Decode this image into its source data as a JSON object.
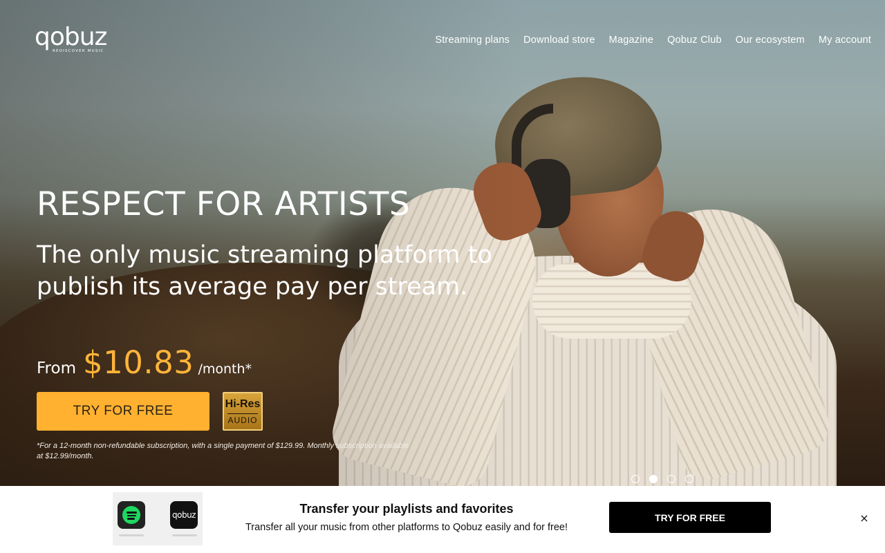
{
  "brand": {
    "logo_text": "qobuz",
    "tagline": "REDISCOVER MUSIC"
  },
  "nav": {
    "items": [
      {
        "label": "Streaming plans"
      },
      {
        "label": "Download store"
      },
      {
        "label": "Magazine"
      },
      {
        "label": "Qobuz Club"
      },
      {
        "label": "Our ecosystem"
      },
      {
        "label": "My account"
      }
    ]
  },
  "hero": {
    "headline": "RESPECT FOR ARTISTS",
    "subheadline": "The only music streaming platform to publish its average pay per stream.",
    "price_from": "From",
    "price_amount": "$10.83",
    "price_per": "/month*",
    "cta_label": "TRY FOR FREE",
    "badge_top": "Hi-Res",
    "badge_bottom": "AUDIO",
    "disclaimer": "*For a 12-month non-refundable subscription, with a single payment of $129.99. Monthly subscription available at $12.99/month.",
    "carousel": {
      "count": 4,
      "active_index": 1
    }
  },
  "banner": {
    "title": "Transfer your playlists and favorites",
    "text": "Transfer all your music from other platforms to Qobuz easily and for free!",
    "cta_label": "TRY FOR FREE",
    "close_symbol": "×",
    "qobuz_icon_text": "qobuz"
  },
  "colors": {
    "accent": "#ffb12f",
    "price": "#ffb53a",
    "banner_cta": "#000000",
    "spotify_green": "#1ed760"
  },
  "icons": [
    "spotify-icon",
    "qobuz-app-icon",
    "hires-audio-badge",
    "close-icon"
  ]
}
